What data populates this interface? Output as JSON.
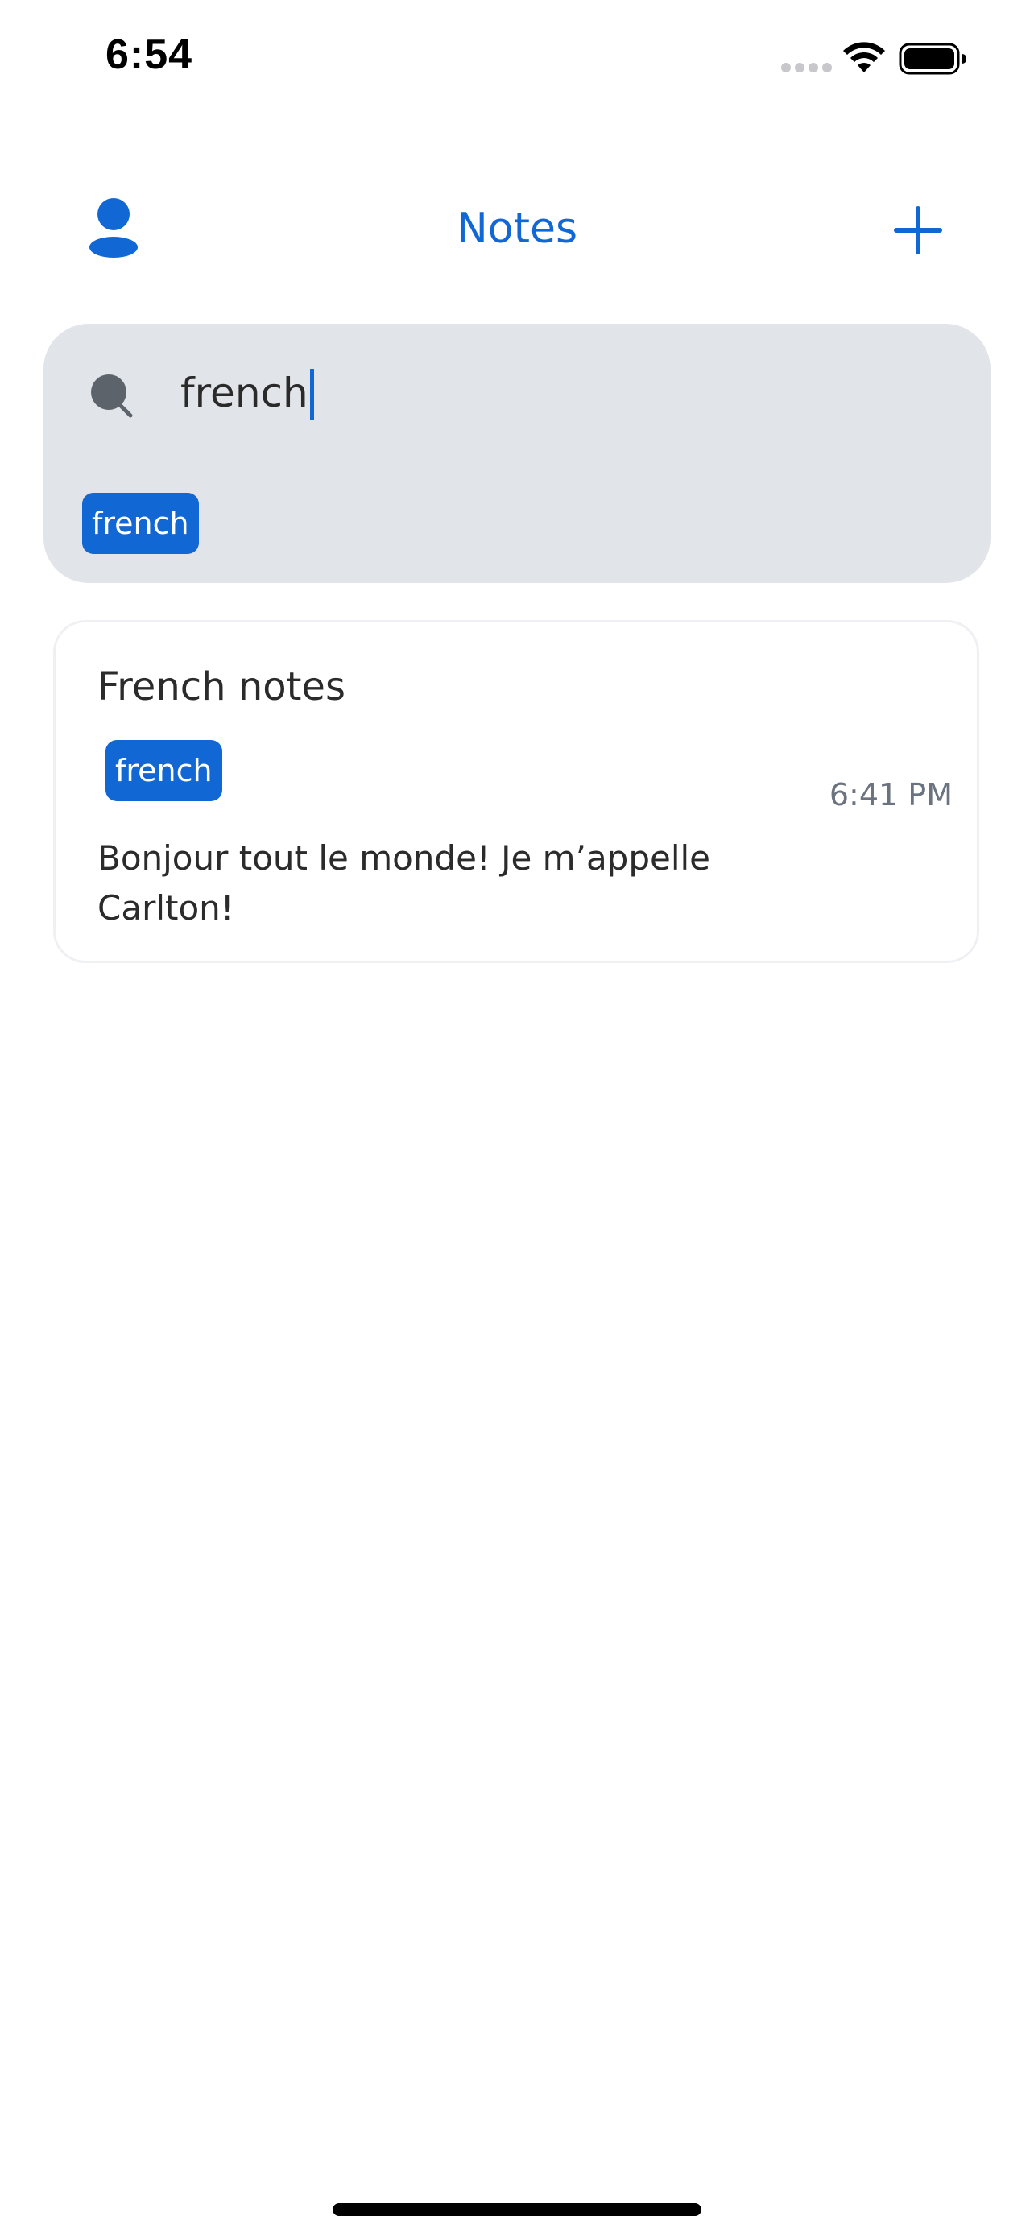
{
  "status_bar": {
    "time": "6:54",
    "icons": [
      "cellular-signal-icon",
      "wifi-icon",
      "battery-icon"
    ]
  },
  "header": {
    "title": "Notes",
    "left_icon": "person-icon",
    "right_icon": "plus-icon"
  },
  "search": {
    "icon": "search-icon",
    "value": "french",
    "tags": [
      "french"
    ]
  },
  "notes": [
    {
      "title": "French notes",
      "tags": [
        "french"
      ],
      "time": "6:41 PM",
      "body": "Bonjour tout le monde! Je m’appelle Carlton!"
    }
  ],
  "colors": {
    "accent": "#1167d4",
    "search_background": "#e1e4e9",
    "muted_text": "#6b7280"
  }
}
